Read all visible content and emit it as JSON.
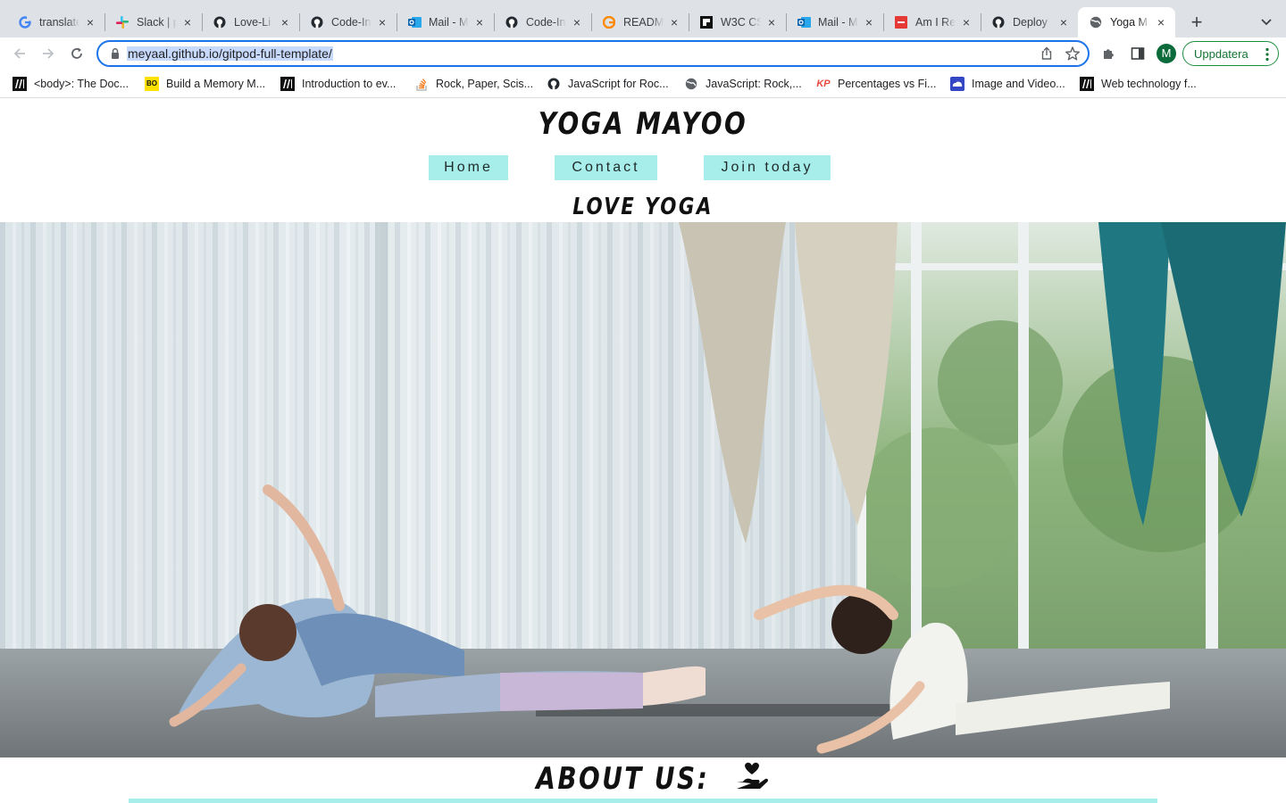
{
  "browser": {
    "tabs": [
      {
        "title": "translate",
        "icon": "google-icon"
      },
      {
        "title": "Slack | p",
        "icon": "slack-icon"
      },
      {
        "title": "Love-Li",
        "icon": "github-icon"
      },
      {
        "title": "Code-In",
        "icon": "github-icon"
      },
      {
        "title": "Mail - M",
        "icon": "outlook-icon"
      },
      {
        "title": "Code-In",
        "icon": "github-icon"
      },
      {
        "title": "README",
        "icon": "gitpod-icon"
      },
      {
        "title": "W3C CS",
        "icon": "w3c-icon"
      },
      {
        "title": "Mail - M",
        "icon": "outlook-icon"
      },
      {
        "title": "Am I Re",
        "icon": "amiresponsive-icon"
      },
      {
        "title": "Deploy",
        "icon": "github-icon"
      },
      {
        "title": "Yoga M",
        "icon": "globe-icon",
        "active": true
      }
    ],
    "url": "meyaal.github.io/gitpod-full-template/",
    "profile_initial": "M",
    "update_label": "Uppdatera",
    "accent": "#1a73e8",
    "bookmarks": [
      {
        "label": "<body>: The Doc...",
        "icon": "mdn-icon"
      },
      {
        "label": "Build a Memory M...",
        "icon": "bo-icon"
      },
      {
        "label": "Introduction to ev...",
        "icon": "mdn-icon"
      },
      {
        "label": "Rock, Paper, Scis...",
        "icon": "stackoverflow-icon"
      },
      {
        "label": "JavaScript for Roc...",
        "icon": "github-icon"
      },
      {
        "label": "JavaScript: Rock,...",
        "icon": "globe-icon"
      },
      {
        "label": "Percentages vs Fi...",
        "icon": "kp-icon"
      },
      {
        "label": "Image and Video...",
        "icon": "cloud-icon"
      },
      {
        "label": "Web technology f...",
        "icon": "mdn-icon"
      }
    ]
  },
  "site": {
    "title": "YOGA MAYOO",
    "nav": [
      "Home",
      "Contact",
      "Join today"
    ],
    "tagline": "LOVE YOGA",
    "about_heading": "ABOUT US:",
    "accent": "#a7ede9"
  }
}
